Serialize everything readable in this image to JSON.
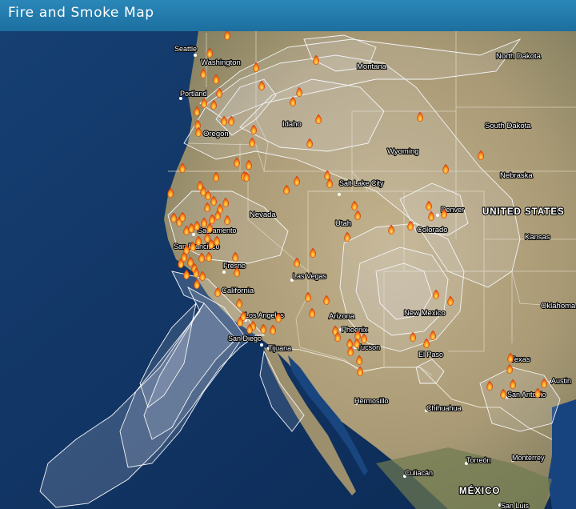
{
  "app": {
    "title": "Fire and Smoke Map"
  },
  "map": {
    "country_labels": [
      "UNITED STATES",
      "MÉXICO"
    ],
    "state_labels": [
      "North Dakota",
      "Montana",
      "Washington",
      "Oregon",
      "Idaho",
      "South Dakota",
      "Wyoming",
      "Nebraska",
      "Nevada",
      "Utah",
      "Colorado",
      "Kansas",
      "California",
      "Arizona",
      "New Mexico",
      "Oklahoma",
      "Texas"
    ],
    "city_labels": [
      "Seattle",
      "Portland",
      "Salt Lake City",
      "Denver",
      "Sacramento",
      "San Francisco",
      "Fresno",
      "Las Vegas",
      "Los Angeles",
      "San Diego",
      "Tijuana",
      "Phoenix",
      "Tucson",
      "El Paso",
      "Hermosillo",
      "Chihuahua",
      "San Antonio",
      "Austin",
      "Torreón",
      "Monterrey",
      "Culiacán",
      "San Luis"
    ],
    "colors": {
      "header": "#1f74a4",
      "ocean": "#123e72",
      "land": "#b3a480",
      "smoke": "#e3e5ea",
      "fire": "#ff7a1a"
    }
  }
}
